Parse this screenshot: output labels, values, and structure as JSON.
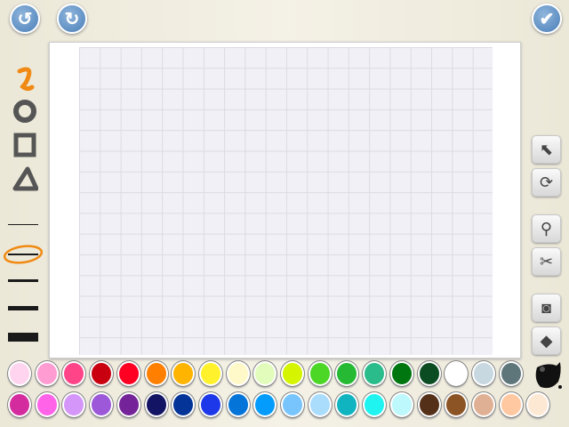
{
  "toolbar": {
    "undo_icon": "undo-icon",
    "redo_icon": "redo-icon",
    "done_icon": "checkmark-icon"
  },
  "tools": [
    "freehand",
    "circle",
    "square",
    "triangle"
  ],
  "brush_sizes": {
    "count": 5,
    "selected_index": 1
  },
  "right_tools": [
    "pointer",
    "rotate",
    "stamp",
    "scissors",
    "camera",
    "paint-bucket"
  ],
  "palette": {
    "row1": [
      "#ffd4ef",
      "#ff9cd2",
      "#ff4488",
      "#c80010",
      "#ff0022",
      "#ff8000",
      "#ffb400",
      "#fff22c",
      "#fff8c8",
      "#e2fcbc",
      "#d4f400",
      "#4cd626",
      "#26ba34",
      "#2abc8a",
      "#007610",
      "#0c4c22",
      "#ffffff",
      "#c8d8e0",
      "#5e767a"
    ],
    "row2": [
      "#d42c9e",
      "#ff64e8",
      "#d496f8",
      "#9c58d8",
      "#742498",
      "#141464",
      "#043498",
      "#1c38e8",
      "#0474d8",
      "#049cfc",
      "#78c4fc",
      "#aadcfc",
      "#10b4c0",
      "#20f4f0",
      "#bcf8fc",
      "#543018",
      "#8c5424",
      "#e0b094",
      "#ffc8a0",
      "#fde8d4"
    ]
  }
}
